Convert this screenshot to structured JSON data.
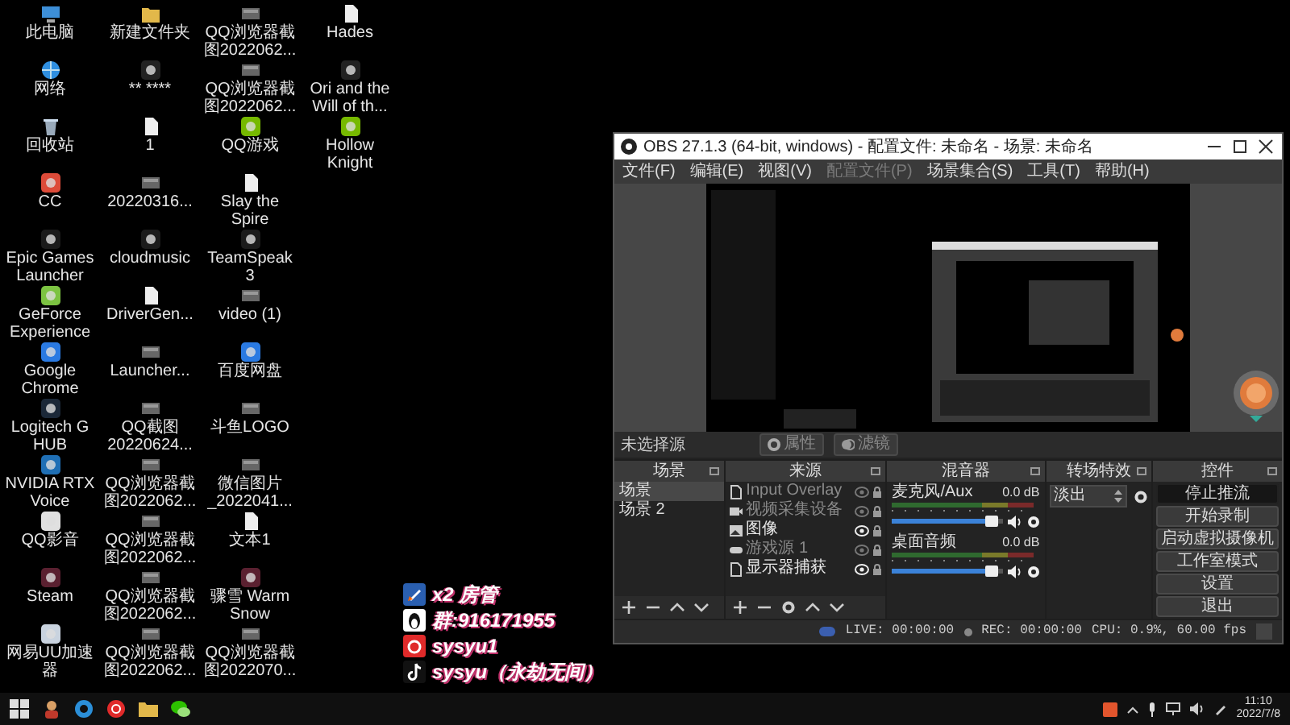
{
  "desktop_icons": [
    {
      "label": "此电脑",
      "kind": "pc"
    },
    {
      "label": "网络",
      "kind": "network"
    },
    {
      "label": "回收站",
      "kind": "recycle"
    },
    {
      "label": "CC",
      "kind": "app"
    },
    {
      "label": "Epic Games Launcher",
      "kind": "app"
    },
    {
      "label": "GeForce Experience",
      "kind": "app"
    },
    {
      "label": "Google Chrome",
      "kind": "app"
    },
    {
      "label": "Logitech G HUB",
      "kind": "app"
    },
    {
      "label": "NVIDIA RTX Voice",
      "kind": "app"
    },
    {
      "label": "QQ影音",
      "kind": "app"
    },
    {
      "label": "Steam",
      "kind": "app"
    },
    {
      "label": "网易UU加速器",
      "kind": "app"
    },
    {
      "label": "新建文件夹",
      "kind": "folder"
    },
    {
      "label": "** ****",
      "kind": "app"
    },
    {
      "label": "1",
      "kind": "file"
    },
    {
      "label": "20220316...",
      "kind": "image"
    },
    {
      "label": "cloudmusic",
      "kind": "app"
    },
    {
      "label": "DriverGen...",
      "kind": "file"
    },
    {
      "label": "Launcher...",
      "kind": "image"
    },
    {
      "label": "QQ截图20220624...",
      "kind": "image"
    },
    {
      "label": "QQ浏览器截图2022062...",
      "kind": "image"
    },
    {
      "label": "QQ浏览器截图2022062...",
      "kind": "image"
    },
    {
      "label": "QQ浏览器截图2022062...",
      "kind": "image"
    },
    {
      "label": "QQ浏览器截图2022062...",
      "kind": "image"
    },
    {
      "label": "QQ浏览器截图2022062...",
      "kind": "image"
    },
    {
      "label": "QQ浏览器截图2022062...",
      "kind": "image"
    },
    {
      "label": "QQ游戏",
      "kind": "app"
    },
    {
      "label": "Slay the Spire",
      "kind": "file"
    },
    {
      "label": "TeamSpeak 3",
      "kind": "app"
    },
    {
      "label": "video (1)",
      "kind": "image"
    },
    {
      "label": "百度网盘",
      "kind": "app"
    },
    {
      "label": "斗鱼LOGO",
      "kind": "image"
    },
    {
      "label": "微信图片_2022041...",
      "kind": "image"
    },
    {
      "label": "文本1",
      "kind": "file"
    },
    {
      "label": "骤雪 Warm Snow",
      "kind": "app"
    },
    {
      "label": "QQ浏览器截图2022070...",
      "kind": "image"
    },
    {
      "label": "Hades",
      "kind": "file"
    },
    {
      "label": "Ori and the Will of th...",
      "kind": "app"
    },
    {
      "label": "Hollow Knight",
      "kind": "app"
    }
  ],
  "obs": {
    "title": "OBS 27.1.3 (64-bit, windows) - 配置文件: 未命名 - 场景: 未命名",
    "menu": [
      {
        "label": "文件(F)",
        "disabled": false
      },
      {
        "label": "编辑(E)",
        "disabled": false
      },
      {
        "label": "视图(V)",
        "disabled": false
      },
      {
        "label": "配置文件(P)",
        "disabled": true
      },
      {
        "label": "场景集合(S)",
        "disabled": false
      },
      {
        "label": "工具(T)",
        "disabled": false
      },
      {
        "label": "帮助(H)",
        "disabled": false
      }
    ],
    "source_status": "未选择源",
    "source_buttons": [
      {
        "label": "属性",
        "disabled": true
      },
      {
        "label": "滤镜",
        "disabled": true
      }
    ],
    "scenes": {
      "title": "场景",
      "items": [
        {
          "label": "场景",
          "selected": true
        },
        {
          "label": "场景 2",
          "selected": false
        }
      ]
    },
    "sources": {
      "title": "来源",
      "items": [
        {
          "name": "Input Overlay",
          "kind": "file",
          "visible": false
        },
        {
          "name": "视频采集设备",
          "kind": "camera",
          "visible": false
        },
        {
          "name": "图像",
          "kind": "image",
          "visible": true
        },
        {
          "name": "游戏源 1",
          "kind": "game",
          "visible": false
        },
        {
          "name": "显示器捕获",
          "kind": "file",
          "visible": true
        }
      ]
    },
    "mixer": {
      "title": "混音器",
      "channels": [
        {
          "name": "麦克风/Aux",
          "reading": "0.0 dB",
          "level": 0.9
        },
        {
          "name": "桌面音频",
          "reading": "0.0 dB",
          "level": 0.9
        }
      ]
    },
    "transitions": {
      "title": "转场特效",
      "selected": "淡出"
    },
    "controls": {
      "title": "控件",
      "buttons": [
        {
          "label": "停止推流",
          "active": true
        },
        {
          "label": "开始录制",
          "active": false
        },
        {
          "label": "启动虚拟摄像机",
          "active": false
        },
        {
          "label": "工作室模式",
          "active": false
        },
        {
          "label": "设置",
          "active": false
        },
        {
          "label": "退出",
          "active": false
        }
      ]
    },
    "status": {
      "live": "LIVE: 00:00:00",
      "rec": "REC: 00:00:00",
      "cpu": "CPU: 0.9%, 60.00 fps"
    }
  },
  "overlay_lines": [
    "x2 房管",
    "群:916171955",
    "sysyu1",
    "sysyu（永劫无间）"
  ],
  "taskbar": {
    "time": "11:10",
    "date": "2022/7/8"
  }
}
